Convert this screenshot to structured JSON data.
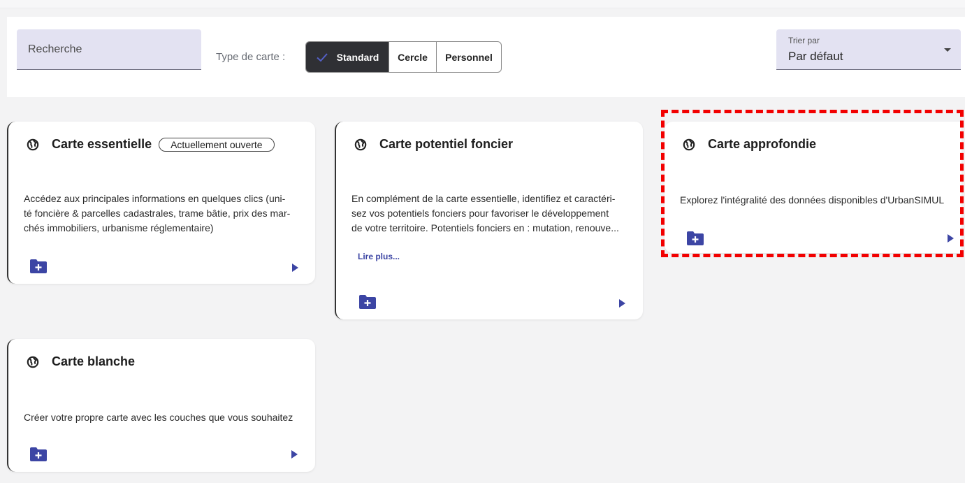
{
  "search": {
    "placeholder": "Recherche"
  },
  "map_type": {
    "label": "Type de carte :",
    "options": [
      "Standard",
      "Cercle",
      "Personnel"
    ],
    "selected": "Standard"
  },
  "sort": {
    "label": "Trier par",
    "value": "Par défaut"
  },
  "cards": [
    {
      "title": "Carte essentielle",
      "badge": "Actuellement ouverte",
      "description": [
        "Accédez aux principales informations en quelques clics (uni-",
        "té foncière & parcelles cadastrales, trame bâtie, prix des mar-",
        "chés immobiliers, urbanisme réglementaire)"
      ]
    },
    {
      "title": "Carte potentiel foncier",
      "description": [
        "En complément de la carte essentielle, identifiez et caractéri-",
        "sez vos potentiels fonciers pour favoriser le développement",
        "de votre territoire. Potentiels fonciers en : mutation, renouve..."
      ],
      "read_more": "Lire plus..."
    },
    {
      "title": "Carte approfondie",
      "description": [
        "Explorez l'intégralité des données disponibles d'UrbanSIMUL"
      ]
    },
    {
      "title": "Carte blanche",
      "description": [
        "Créer votre propre carte avec les couches que vous souhaitez"
      ]
    }
  ],
  "colors": {
    "accent": "#3c45a4",
    "highlight": "#f20000",
    "field_bg": "#e3e2f2"
  },
  "icons": {
    "card_icon": "globe-icon",
    "new_folder": "folder-plus-icon",
    "open": "play-icon"
  }
}
